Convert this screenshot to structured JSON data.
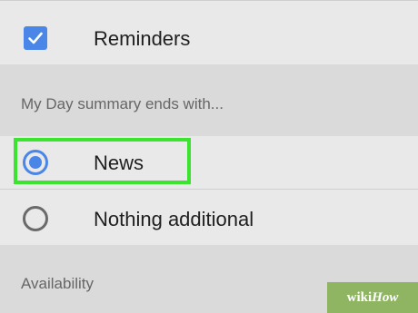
{
  "settings": {
    "reminders": {
      "label": "Reminders",
      "checked": true,
      "icon": "checkbox-checked-icon"
    },
    "my_day_section": {
      "title": "My Day summary ends with..."
    },
    "options": [
      {
        "label": "News",
        "selected": true,
        "icon": "radio-selected-icon"
      },
      {
        "label": "Nothing additional",
        "selected": false,
        "icon": "radio-unselected-icon"
      }
    ],
    "availability_section": {
      "title": "Availability"
    }
  },
  "highlight": {
    "color": "#3be52f",
    "target": "News"
  },
  "colors": {
    "accent": "#4a86e8",
    "item_background": "#e9e9e9",
    "section_background": "#dadada"
  },
  "watermark": {
    "prefix": "wiki",
    "suffix": "How"
  }
}
